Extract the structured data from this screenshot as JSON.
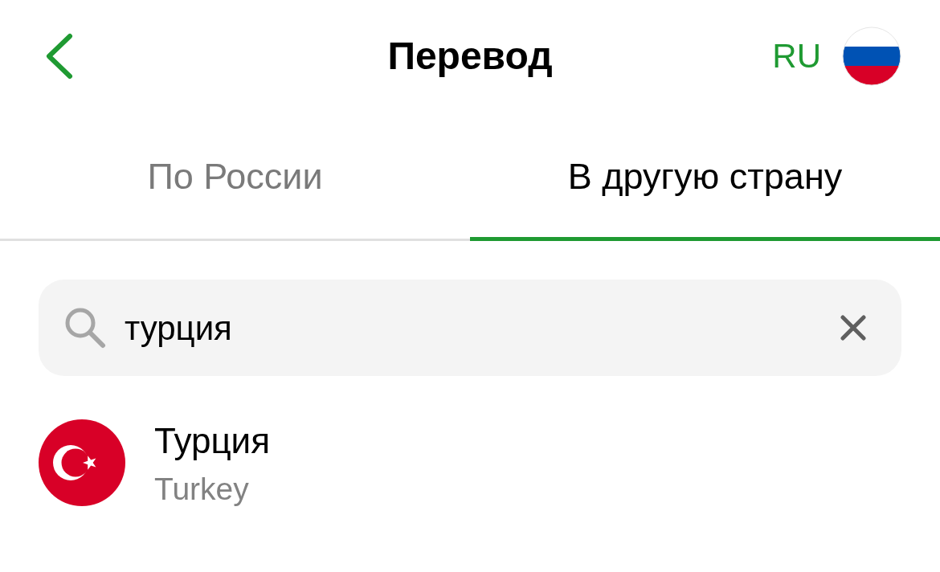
{
  "header": {
    "title": "Перевод",
    "language": "RU"
  },
  "tabs": [
    {
      "label": "По России",
      "selected": false
    },
    {
      "label": "В другую страну",
      "selected": true
    }
  ],
  "search": {
    "value": "турция"
  },
  "results": [
    {
      "name": "Турция",
      "subtitle": "Turkey"
    }
  ]
}
